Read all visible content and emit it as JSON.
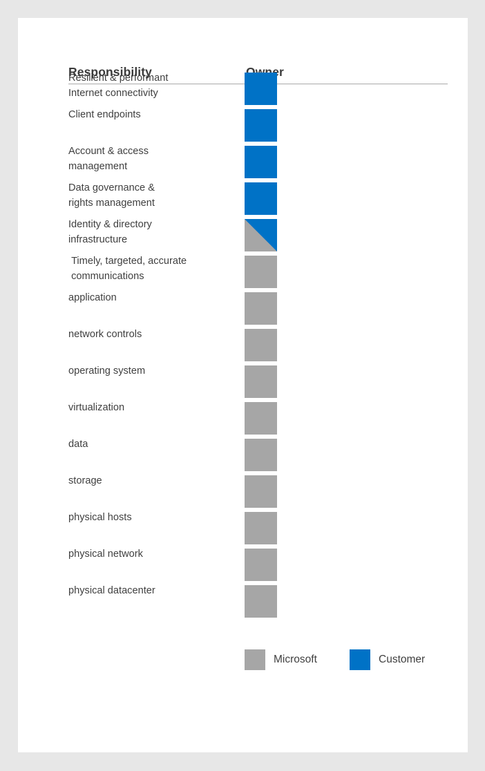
{
  "colors": {
    "customer": "#0072C6",
    "microsoft": "#A6A6A6",
    "text": "#404040",
    "rule": "#A9A9A9",
    "page_background": "#E7E7E7",
    "sheet_background": "#FFFFFF"
  },
  "table": {
    "headers": {
      "responsibility": "Responsibility",
      "owner": "Owner"
    },
    "rows": [
      {
        "label": "Resilient & performant\nInternet connectivity",
        "owner": "customer",
        "owner_label": "Customer"
      },
      {
        "label": "Client endpoints",
        "owner": "customer",
        "owner_label": "Customer"
      },
      {
        "label": "Account & access\nmanagement",
        "owner": "customer",
        "owner_label": "Customer"
      },
      {
        "label": "Data governance &\nrights management",
        "owner": "customer",
        "owner_label": "Customer"
      },
      {
        "label": "Identity & directory\ninfrastructure",
        "owner": "split",
        "owner_label": "Microsoft and Customer"
      },
      {
        "label": " Timely, targeted, accurate\n communications",
        "owner": "microsoft",
        "owner_label": "Microsoft"
      },
      {
        "label": "application",
        "owner": "microsoft",
        "owner_label": "Microsoft"
      },
      {
        "label": "network controls",
        "owner": "microsoft",
        "owner_label": "Microsoft"
      },
      {
        "label": "operating system",
        "owner": "microsoft",
        "owner_label": "Microsoft"
      },
      {
        "label": "virtualization",
        "owner": "microsoft",
        "owner_label": "Microsoft"
      },
      {
        "label": "data",
        "owner": "microsoft",
        "owner_label": "Microsoft"
      },
      {
        "label": "storage",
        "owner": "microsoft",
        "owner_label": "Microsoft"
      },
      {
        "label": "physical hosts",
        "owner": "microsoft",
        "owner_label": "Microsoft"
      },
      {
        "label": "physical network",
        "owner": "microsoft",
        "owner_label": "Microsoft"
      },
      {
        "label": "physical datacenter",
        "owner": "microsoft",
        "owner_label": "Microsoft"
      }
    ]
  },
  "legend": {
    "items": [
      {
        "key": "microsoft",
        "label": "Microsoft"
      },
      {
        "key": "customer",
        "label": "Customer"
      }
    ]
  }
}
